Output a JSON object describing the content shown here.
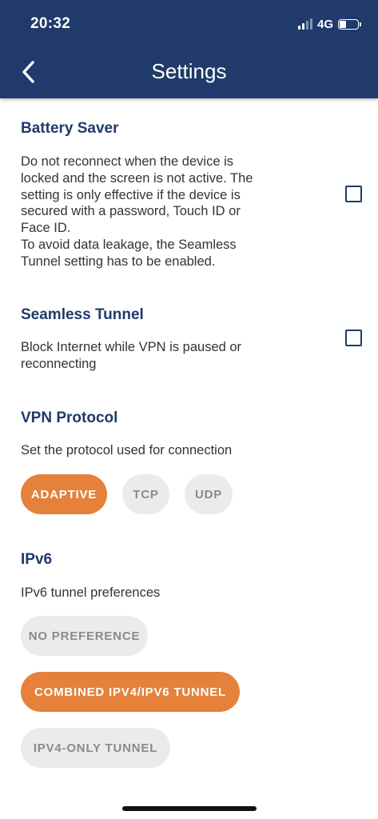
{
  "status_bar": {
    "time": "20:32",
    "network": "4G"
  },
  "header": {
    "title": "Settings"
  },
  "battery_saver": {
    "title": "Battery Saver",
    "lines": [
      "Do not reconnect when the device is",
      "locked and the screen is not active. The",
      "setting is only effective if the device is",
      "secured with a password, Touch ID or",
      "Face ID.",
      "To avoid data leakage, the Seamless",
      "Tunnel setting has to be enabled."
    ],
    "checked": false
  },
  "seamless_tunnel": {
    "title": "Seamless Tunnel",
    "lines": [
      "Block Internet while VPN is paused or",
      "reconnecting"
    ],
    "checked": false
  },
  "vpn_protocol": {
    "title": "VPN Protocol",
    "description": "Set the protocol used for connection",
    "options": [
      "ADAPTIVE",
      "TCP",
      "UDP"
    ],
    "selected": "ADAPTIVE"
  },
  "ipv6": {
    "title": "IPv6",
    "description": "IPv6 tunnel preferences",
    "options": [
      "NO PREFERENCE",
      "COMBINED IPV4/IPV6 TUNNEL",
      "IPV4-ONLY TUNNEL"
    ],
    "selected": "COMBINED IPV4/IPV6 TUNNEL"
  },
  "colors": {
    "header": "#1f3a6b",
    "accent": "#e5813a",
    "pill_inactive": "#ebebeb"
  }
}
